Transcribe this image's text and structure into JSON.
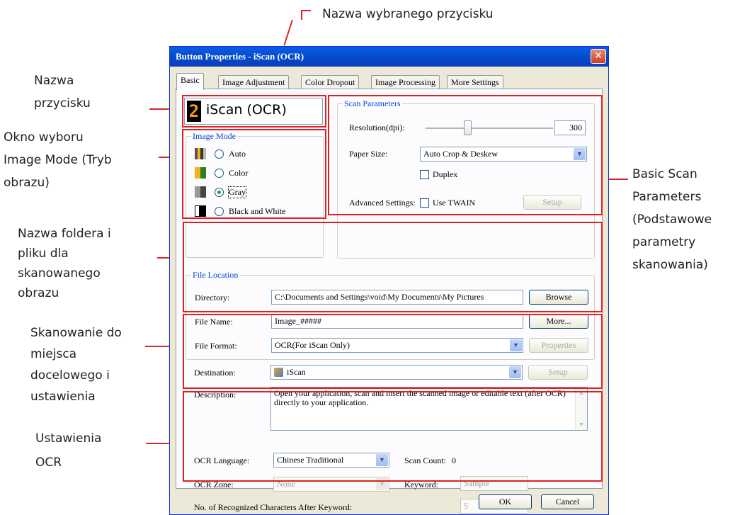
{
  "callouts": {
    "top": "Nazwa wybranego przycisku",
    "button_name": [
      "Nazwa",
      "przycisku"
    ],
    "image_mode": [
      "Okno wyboru",
      "Image Mode (Tryb",
      "obrazu)"
    ],
    "folder": [
      "Nazwa foldera i",
      "pliku dla",
      "skanowanego",
      "obrazu"
    ],
    "destination": [
      "Skanowanie do",
      "miejsca",
      "docelowego i",
      "ustawienia"
    ],
    "ocr": [
      "Ustawienia",
      "OCR"
    ],
    "basic_scan": [
      "Basic Scan",
      "Parameters",
      "(Podstawowe",
      "parametry",
      "skanowania)"
    ]
  },
  "window": {
    "title": "Button Properties - iScan (OCR)",
    "close": "✕",
    "tabs": [
      "Basic",
      "Image Adjustment",
      "Color Dropout",
      "Image Processing",
      "More Settings"
    ]
  },
  "button_name": {
    "label": "iScan (OCR)",
    "number": "2"
  },
  "image_mode": {
    "legend": "Image Mode",
    "options": [
      "Auto",
      "Color",
      "Gray",
      "Black and White"
    ],
    "selected": "Gray"
  },
  "scan_parameters": {
    "legend": "Scan Parameters",
    "resolution_label": "Resolution(dpi):",
    "resolution_value": "300",
    "paper_size_label": "Paper Size:",
    "paper_size_value": "Auto Crop & Deskew",
    "duplex_label": "Duplex",
    "advanced_label": "Advanced Settings:",
    "twain_label": "Use TWAIN",
    "setup": "Setup"
  },
  "file_location": {
    "legend": "File Location",
    "directory_label": "Directory:",
    "directory_value": "C:\\Documents and Settings\\void\\My Documents\\My Pictures",
    "browse": "Browse",
    "file_name_label": "File Name:",
    "file_name_value": "Image_#####",
    "more": "More...",
    "file_format_label": "File Format:",
    "file_format_value": "OCR(For iScan Only)",
    "properties": "Properties"
  },
  "destination": {
    "label": "Destination:",
    "value": "iScan",
    "setup": "Setup",
    "description_label": "Description:",
    "description_text": "Open your application, scan and insert the scanned image or editable text (after OCR) directly to your application."
  },
  "ocr": {
    "language_label": "OCR Language:",
    "language_value": "Chinese Traditional",
    "scan_count_label": "Scan Count:",
    "scan_count_value": "0",
    "zone_label": "OCR Zone:",
    "zone_value": "None",
    "keyword_label": "Keyword:",
    "keyword_value": "Sample",
    "chars_label": "No. of Recognized Characters After Keyword:",
    "chars_value": "5"
  },
  "footer": {
    "ok": "OK",
    "cancel": "Cancel"
  },
  "colors": {
    "accent": "#0046d5",
    "callout_red": "#e02020"
  }
}
